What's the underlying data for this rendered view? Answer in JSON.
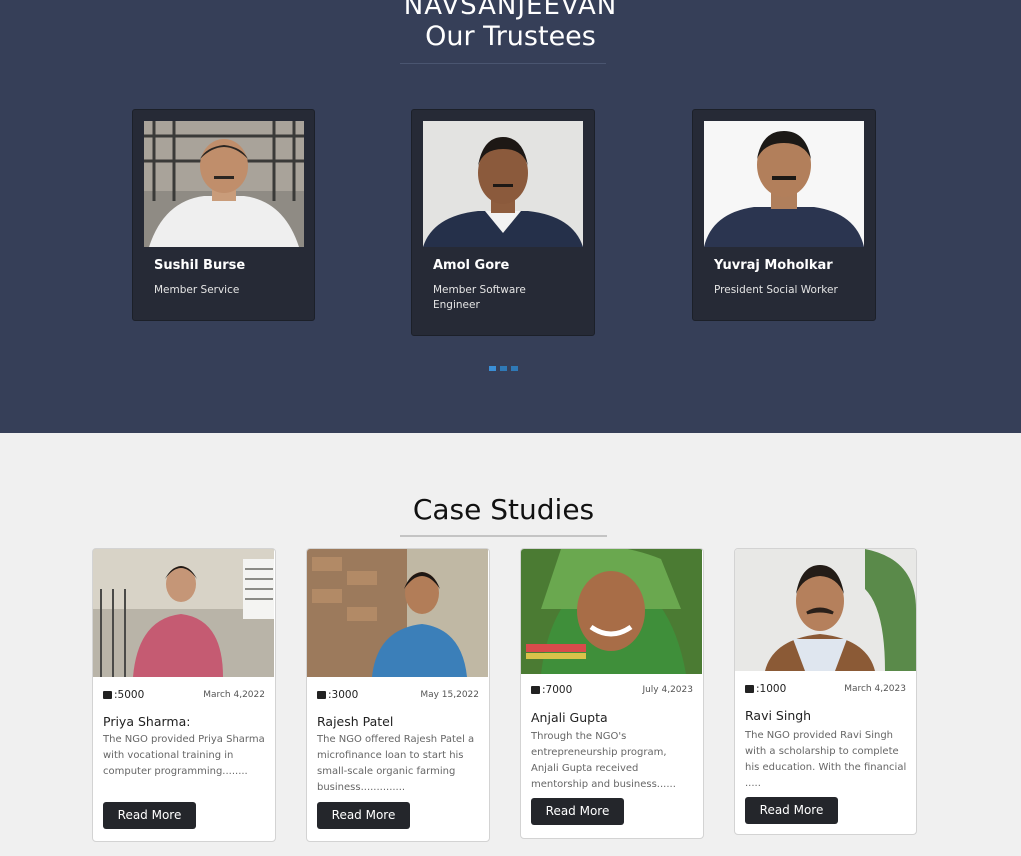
{
  "trustees_section": {
    "brand": "NAVSANJEEVAN",
    "title": "Our Trustees",
    "trustees": [
      {
        "name": "Sushil Burse",
        "role": "Member Service"
      },
      {
        "name": "Amol Gore",
        "role": "Member Software Engineer"
      },
      {
        "name": "Yuvraj Moholkar",
        "role": "President Social Worker"
      }
    ],
    "carousel_pages": 3,
    "carousel_active_index": 0
  },
  "case_studies": {
    "title": "Case Studies",
    "button_label": "Read More",
    "items": [
      {
        "amount": ":5000",
        "date": "March 4,2022",
        "name": "Priya Sharma:",
        "description": "The NGO provided Priya Sharma with vocational training in computer programming........"
      },
      {
        "amount": ":3000",
        "date": "May 15,2022",
        "name": "Rajesh Patel",
        "description": "The NGO offered Rajesh Patel a microfinance loan to start his small-scale organic farming business.............."
      },
      {
        "amount": ":7000",
        "date": "July 4,2023",
        "name": "Anjali Gupta",
        "description": "Through the NGO's entrepreneurship program, Anjali Gupta received mentorship and business......"
      },
      {
        "amount": ":1000",
        "date": "March 4,2023",
        "name": "Ravi Singh",
        "description": "The NGO provided Ravi Singh with a scholarship to complete his education. With the financial ....."
      }
    ]
  },
  "colors": {
    "trustees_bg": "#363f58",
    "card_dark": "#262a36",
    "button_dark": "#24262b",
    "carousel_accent": "#2f79b6"
  }
}
